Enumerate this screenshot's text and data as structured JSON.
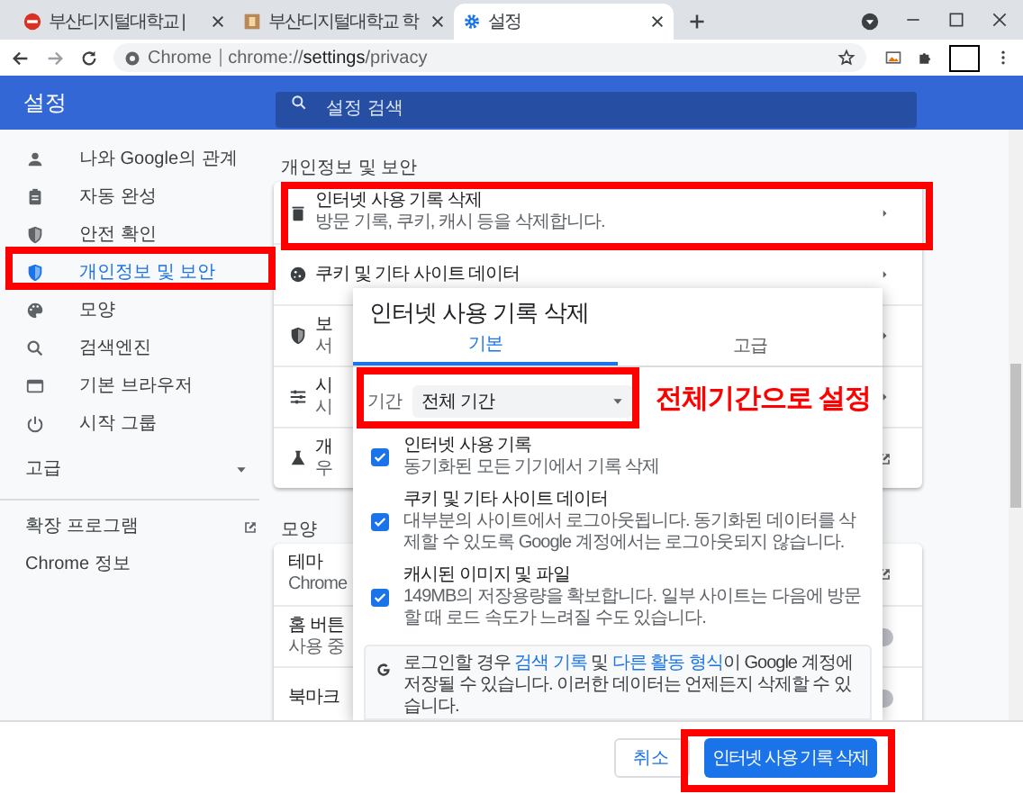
{
  "browser": {
    "tabs": [
      {
        "title": "부산디지털대학교 |",
        "selected": false
      },
      {
        "title": "부산디지털대학교 학",
        "selected": false
      },
      {
        "title": "설정",
        "selected": true
      }
    ],
    "address": {
      "site_label": "Chrome",
      "url_plain": "chrome://",
      "url_strong": "settings",
      "url_rest": "/privacy"
    }
  },
  "header": {
    "title": "설정",
    "search": {
      "placeholder": "설정 검색"
    }
  },
  "sidebar": {
    "items": [
      {
        "label": "나와 Google의 관계",
        "selected": false
      },
      {
        "label": "자동 완성",
        "selected": false
      },
      {
        "label": "안전 확인",
        "selected": false
      },
      {
        "label": "개인정보 및 보안",
        "selected": true
      },
      {
        "label": "모양",
        "selected": false
      },
      {
        "label": "검색엔진",
        "selected": false
      },
      {
        "label": "기본 브라우저",
        "selected": false
      },
      {
        "label": "시작 그룹",
        "selected": false
      }
    ],
    "advanced": {
      "label": "고급",
      "expanded": false
    },
    "links": [
      {
        "label": "확장 프로그램",
        "external": true
      },
      {
        "label": "Chrome 정보",
        "external": false
      }
    ]
  },
  "sections": [
    {
      "heading": "개인정보 및 보안",
      "rows": [
        {
          "title": "인터넷 사용 기록 삭제",
          "subtitle": "방문 기록, 쿠키, 캐시 등을 삭제합니다.",
          "kind": "chevron"
        },
        {
          "title": "쿠키 및 기타 사이트 데이터",
          "kind": "chevron"
        },
        {
          "title": "보",
          "subtitle": "서",
          "kind": "chevron"
        },
        {
          "title": "시",
          "subtitle": "시",
          "kind": "chevron"
        },
        {
          "title": "개",
          "subtitle": "우",
          "kind": "external"
        }
      ]
    },
    {
      "heading": "모양",
      "rows": [
        {
          "title": "테마",
          "subtitle": "Chrome",
          "kind": "external"
        },
        {
          "title": "홈 버튼",
          "subtitle": "사용 중",
          "kind": "toggle",
          "on": false
        },
        {
          "title": "북마크",
          "kind": "toggle",
          "on": false
        }
      ]
    }
  ],
  "dialog": {
    "title": "인터넷 사용 기록 삭제",
    "tabs": [
      {
        "label": "기본",
        "selected": true
      },
      {
        "label": "고급",
        "selected": false
      }
    ],
    "time_range": {
      "label": "기간",
      "value": "전체 기간"
    },
    "options": [
      {
        "title": "인터넷 사용 기록",
        "description": "동기화된 모든 기기에서 기록 삭제",
        "checked": true
      },
      {
        "title": "쿠키 및 기타 사이트 데이터",
        "description": "대부분의 사이트에서 로그아웃됩니다. 동기화된 데이터를 삭제할 수 있도록 Google 계정에서는 로그아웃되지 않습니다.",
        "checked": true
      },
      {
        "title": "캐시된 이미지 및 파일",
        "description": "149MB의 저장용량을 확보합니다. 일부 사이트는 다음에 방문할 때 로드 속도가 느려질 수도 있습니다.",
        "checked": true
      }
    ],
    "notice": [
      {
        "text": "로그인할 경우 ",
        "link": false
      },
      {
        "text": "검색 기록",
        "link": true
      },
      {
        "text": " 및 ",
        "link": false
      },
      {
        "text": "다른 활동 형식",
        "link": true
      },
      {
        "text": "이 Google 계정에 저장될 수 있습니다. 이러한 데이터는 언제든지 삭제할 수 있습니다.",
        "link": false
      }
    ],
    "buttons": [
      {
        "label": "취소",
        "kind": "secondary"
      },
      {
        "label": "인터넷 사용 기록 삭제",
        "kind": "primary"
      }
    ]
  },
  "annotation": {
    "text": "전체기간으로 설정"
  }
}
